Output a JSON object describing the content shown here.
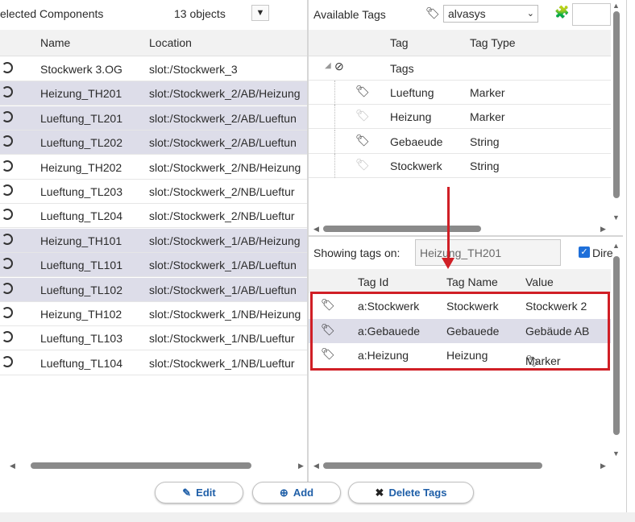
{
  "left": {
    "title": "elected Components",
    "count": "13 objects",
    "dropdown_glyph": "▼",
    "columns": {
      "name": "Name",
      "location": "Location"
    },
    "rows": [
      {
        "name": "Stockwerk 3.OG",
        "location": "slot:/Stockwerk_3",
        "selected": false
      },
      {
        "name": "Heizung_TH201",
        "location": "slot:/Stockwerk_2/AB/Heizung",
        "selected": true
      },
      {
        "name": "Lueftung_TL201",
        "location": "slot:/Stockwerk_2/AB/Lueftun",
        "selected": true
      },
      {
        "name": "Lueftung_TL202",
        "location": "slot:/Stockwerk_2/AB/Lueftun",
        "selected": true
      },
      {
        "name": "Heizung_TH202",
        "location": "slot:/Stockwerk_2/NB/Heizung",
        "selected": false
      },
      {
        "name": "Lueftung_TL203",
        "location": "slot:/Stockwerk_2/NB/Lueftur",
        "selected": false
      },
      {
        "name": "Lueftung_TL204",
        "location": "slot:/Stockwerk_2/NB/Lueftur",
        "selected": false
      },
      {
        "name": "Heizung_TH101",
        "location": "slot:/Stockwerk_1/AB/Heizung",
        "selected": true
      },
      {
        "name": "Lueftung_TL101",
        "location": "slot:/Stockwerk_1/AB/Lueftun",
        "selected": true
      },
      {
        "name": "Lueftung_TL102",
        "location": "slot:/Stockwerk_1/AB/Lueftun",
        "selected": true
      },
      {
        "name": "Heizung_TH102",
        "location": "slot:/Stockwerk_1/NB/Heizung",
        "selected": false
      },
      {
        "name": "Lueftung_TL103",
        "location": "slot:/Stockwerk_1/NB/Lueftur",
        "selected": false
      },
      {
        "name": "Lueftung_TL104",
        "location": "slot:/Stockwerk_1/NB/Lueftur",
        "selected": false
      }
    ]
  },
  "available": {
    "label": "Available Tags",
    "system": "alvasys",
    "columns": {
      "tag": "Tag",
      "type": "Tag Type"
    },
    "root": "Tags",
    "tags": [
      {
        "tag": "Lueftung",
        "type": "Marker",
        "icon": "tag-icon-dark"
      },
      {
        "tag": "Heizung",
        "type": "Marker",
        "icon": "tag-icon-light"
      },
      {
        "tag": "Gebaeude",
        "type": "String",
        "icon": "tag-icon-dark"
      },
      {
        "tag": "Stockwerk",
        "type": "String",
        "icon": "tag-icon-light"
      }
    ]
  },
  "instance": {
    "showing_label": "Showing tags on:",
    "showing_value": "Heizung_TH201",
    "direct_label": "Dire",
    "direct_checked": true,
    "columns": {
      "id": "Tag Id",
      "name": "Tag Name",
      "value": "Value"
    },
    "rows": [
      {
        "id": "a:Stockwerk",
        "name": "Stockwerk",
        "value": "Stockwerk 2"
      },
      {
        "id": "a:Gebauede",
        "name": "Gebauede",
        "value": "Gebäude AB"
      },
      {
        "id": "a:Heizung",
        "name": "Heizung",
        "value": "Marker"
      }
    ]
  },
  "buttons": {
    "edit": "Edit",
    "add": "Add",
    "delete": "Delete Tags"
  },
  "colors": {
    "selection": "#dddde9",
    "highlight": "#d01f26",
    "link": "#1f5fa8"
  }
}
